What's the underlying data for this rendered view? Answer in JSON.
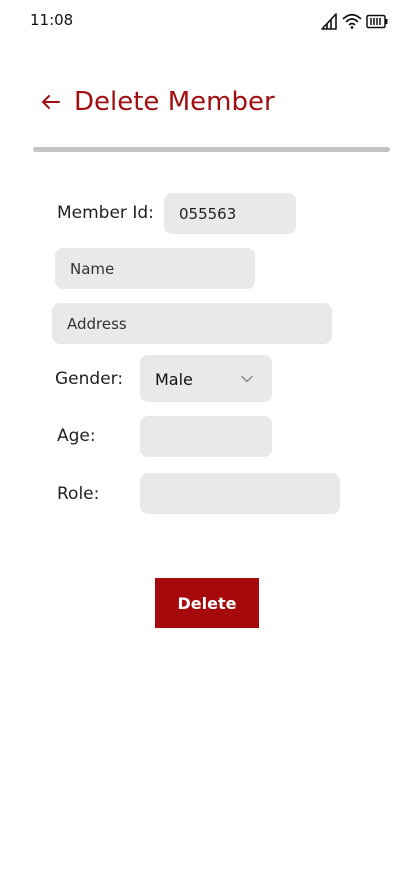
{
  "status_bar": {
    "time": "11:08",
    "icons": [
      "signal-icon",
      "wifi-icon",
      "battery-icon"
    ]
  },
  "header": {
    "back_icon": "arrow-left-icon",
    "title": "Delete Member"
  },
  "colors": {
    "accent": "#a20f12",
    "button": "#a6090c",
    "field_background": "#e9e9e9",
    "divider": "#c4c4c4"
  },
  "form": {
    "member_id": {
      "label": "Member Id:",
      "value": "055563"
    },
    "name": {
      "placeholder": "Name",
      "value": ""
    },
    "address": {
      "placeholder": "Address",
      "value": ""
    },
    "gender": {
      "label": "Gender:",
      "selected": "Male",
      "icon": "chevron-down-icon"
    },
    "age": {
      "label": "Age:",
      "value": ""
    },
    "role": {
      "label": "Role:",
      "value": ""
    }
  },
  "actions": {
    "delete_label": "Delete"
  }
}
